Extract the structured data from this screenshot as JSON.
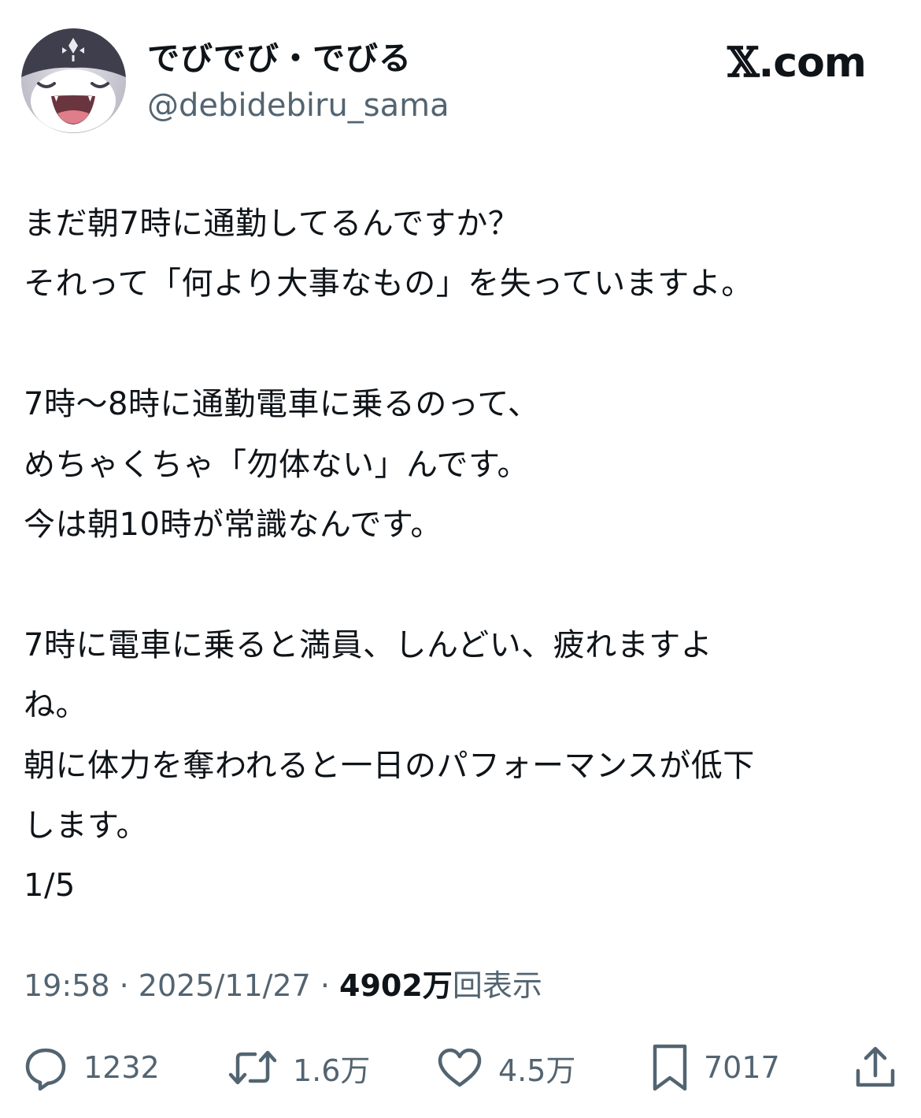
{
  "author": {
    "display_name": "でびでび・でびる",
    "handle": "@debidebiru_sama"
  },
  "brand": {
    "mark": "𝕏",
    "domain": ".com"
  },
  "tweet": {
    "lines": [
      "まだ朝7時に通勤してるんですか？",
      "それって「何より大事なもの」を失っていますよ。",
      "",
      "7時〜8時に通勤電車に乗るのって、",
      "めちゃくちゃ「勿体ない」んです。",
      "今は朝10時が常識なんです。",
      "",
      "7時に電車に乗ると満員、しんどい、疲れますよ",
      "ね。",
      "朝に体力を奪われると一日のパフォーマンスが低下",
      "します。",
      "1/5"
    ]
  },
  "meta": {
    "time": "19:58",
    "separator": " · ",
    "date": "2025/11/27",
    "views_count": "4902万",
    "views_label": "回表示"
  },
  "actions": {
    "replies": "1232",
    "reposts": "1.6万",
    "likes": "4.5万",
    "bookmarks": "7017"
  },
  "icons": {
    "reply": "reply-icon",
    "repost": "repost-icon",
    "like": "heart-icon",
    "bookmark": "bookmark-icon",
    "share": "share-icon"
  },
  "colors": {
    "text": "#0f1419",
    "secondary": "#536471",
    "background": "#ffffff"
  }
}
